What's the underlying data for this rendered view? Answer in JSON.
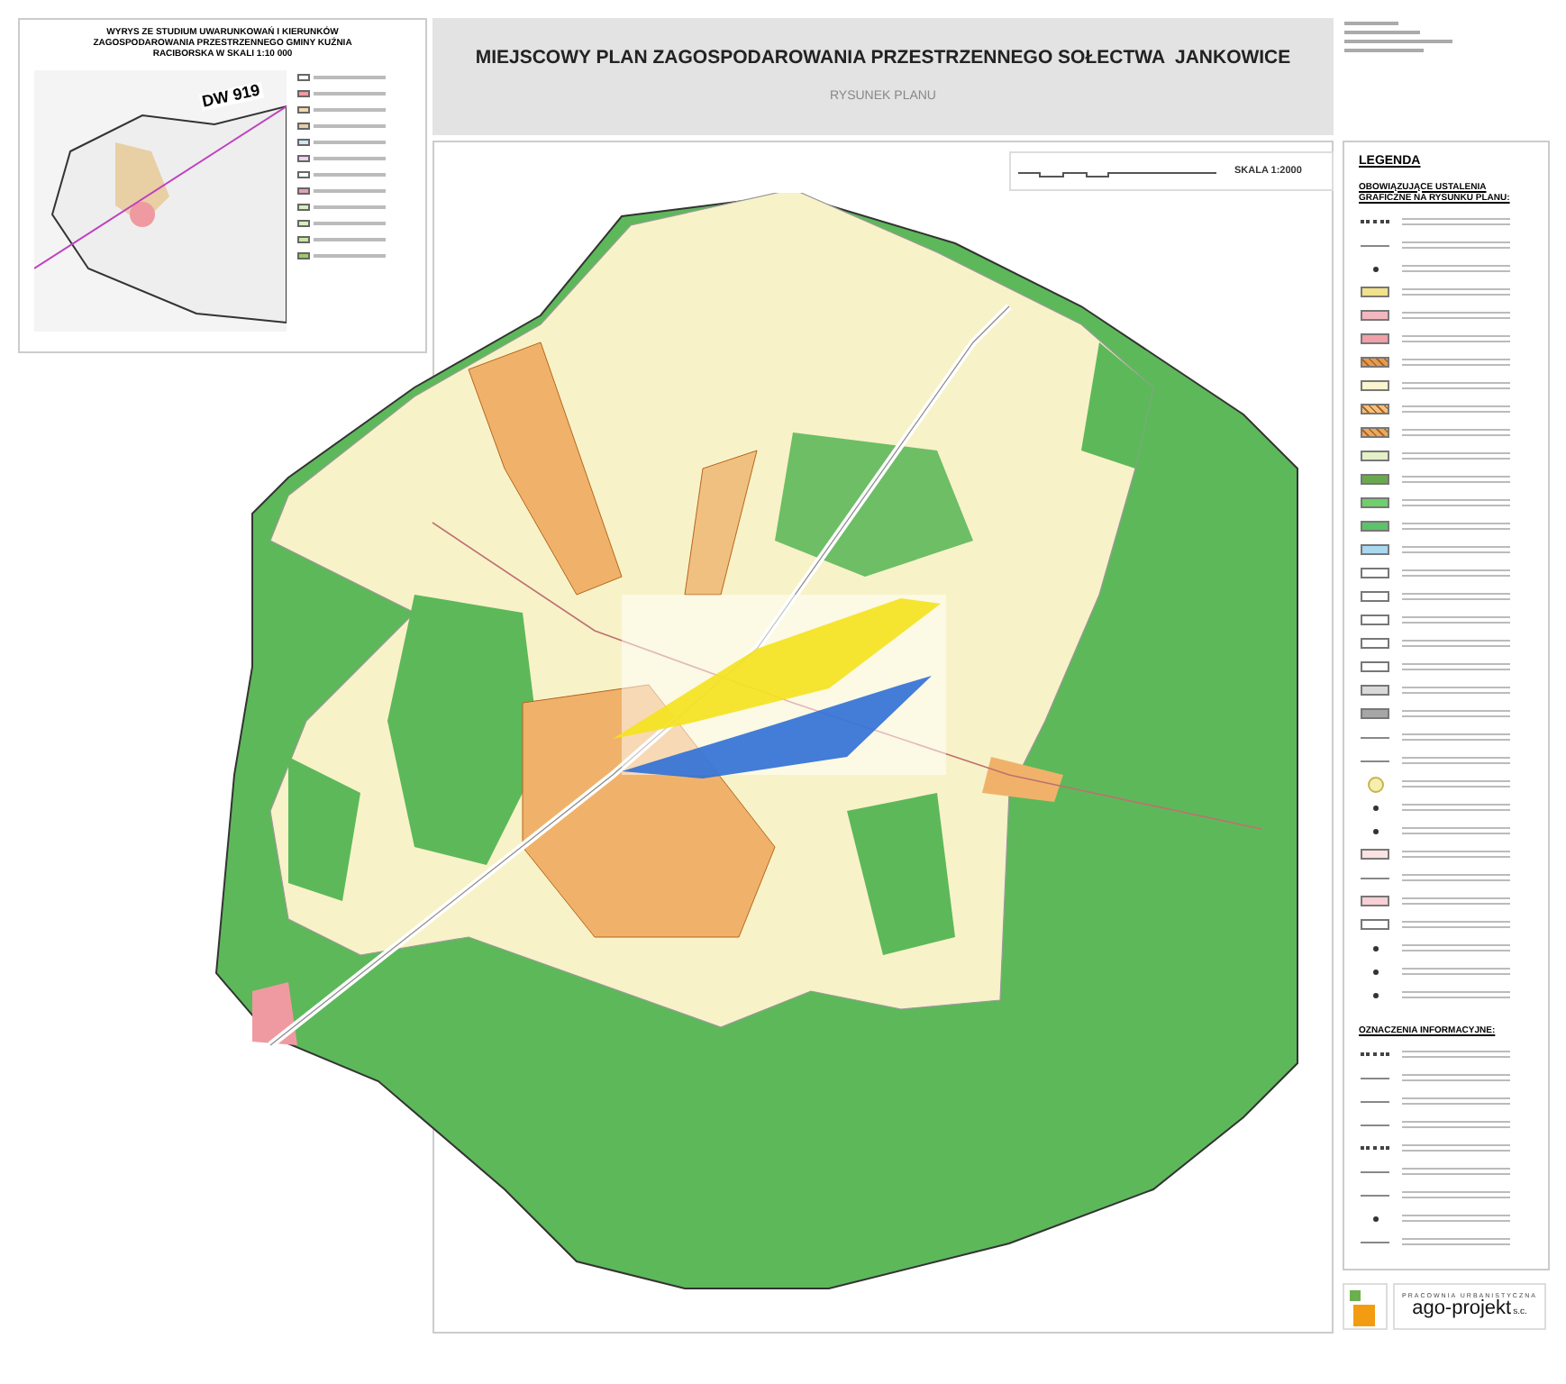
{
  "inset": {
    "title": "WYRYS ZE STUDIUM UWARUNKOWAŃ I KIERUNKÓW ZAGOSPODAROWANIA PRZESTRZENNEGO GMINY KUŹNIA RACIBORSKA W SKALI 1:10 000",
    "road_label": "DW 919"
  },
  "header": {
    "title": "MIEJSCOWY PLAN ZAGOSPODAROWANIA PRZESTRZENNEGO SOŁECTWA  JANKOWICE",
    "subtitle": "RYSUNEK PLANU"
  },
  "scale": {
    "label": "SKALA 1:2000"
  },
  "legend": {
    "title": "LEGENDA",
    "sections": [
      {
        "heading": "OBOWIĄZUJĄCE USTALENIA GRAFICZNE NA RYSUNKU PLANU:",
        "items": [
          {
            "kind": "dotted"
          },
          {
            "kind": "line"
          },
          {
            "kind": "letter"
          },
          {
            "kind": "swatch",
            "color": "#f3e08a"
          },
          {
            "kind": "swatch",
            "color": "#f2b8c0"
          },
          {
            "kind": "swatch",
            "color": "#f0a0a8"
          },
          {
            "kind": "hatched",
            "color": "#e39a55"
          },
          {
            "kind": "swatch",
            "color": "#fbf5cf"
          },
          {
            "kind": "hatched",
            "color": "#f0c080"
          },
          {
            "kind": "hatched",
            "color": "#e8a860"
          },
          {
            "kind": "swatch",
            "color": "#e4f0c8"
          },
          {
            "kind": "swatch",
            "color": "#6aa84f"
          },
          {
            "kind": "swatch",
            "color": "#6fcf6a"
          },
          {
            "kind": "swatch",
            "color": "#5cc36a"
          },
          {
            "kind": "swatch",
            "color": "#a9d8ef"
          },
          {
            "kind": "swatch",
            "color": "#ffffff"
          },
          {
            "kind": "swatch",
            "color": "#ffffff"
          },
          {
            "kind": "swatch",
            "color": "#ffffff"
          },
          {
            "kind": "swatch",
            "color": "#ffffff"
          },
          {
            "kind": "swatch",
            "color": "#ffffff"
          },
          {
            "kind": "swatch",
            "color": "#d9d9d9"
          },
          {
            "kind": "swatch",
            "color": "#a6a6a6"
          },
          {
            "kind": "line"
          },
          {
            "kind": "line"
          },
          {
            "kind": "circle"
          },
          {
            "kind": "marker"
          },
          {
            "kind": "marker"
          },
          {
            "kind": "swatch",
            "color": "#fbe3e3"
          },
          {
            "kind": "line"
          },
          {
            "kind": "swatch",
            "color": "#f6d0d4"
          },
          {
            "kind": "swatch",
            "color": "#ffffff"
          },
          {
            "kind": "marker"
          },
          {
            "kind": "marker"
          },
          {
            "kind": "marker"
          }
        ]
      },
      {
        "heading": "OZNACZENIA INFORMACYJNE:",
        "items": [
          {
            "kind": "dotted"
          },
          {
            "kind": "line"
          },
          {
            "kind": "line"
          },
          {
            "kind": "line"
          },
          {
            "kind": "dotted"
          },
          {
            "kind": "line"
          },
          {
            "kind": "line"
          },
          {
            "kind": "marker"
          },
          {
            "kind": "line"
          }
        ]
      }
    ]
  },
  "firm": {
    "tagline": "PRACOWNIA URBANISTYCZNA",
    "name": "ago-projekt",
    "suffix": "s.c."
  }
}
